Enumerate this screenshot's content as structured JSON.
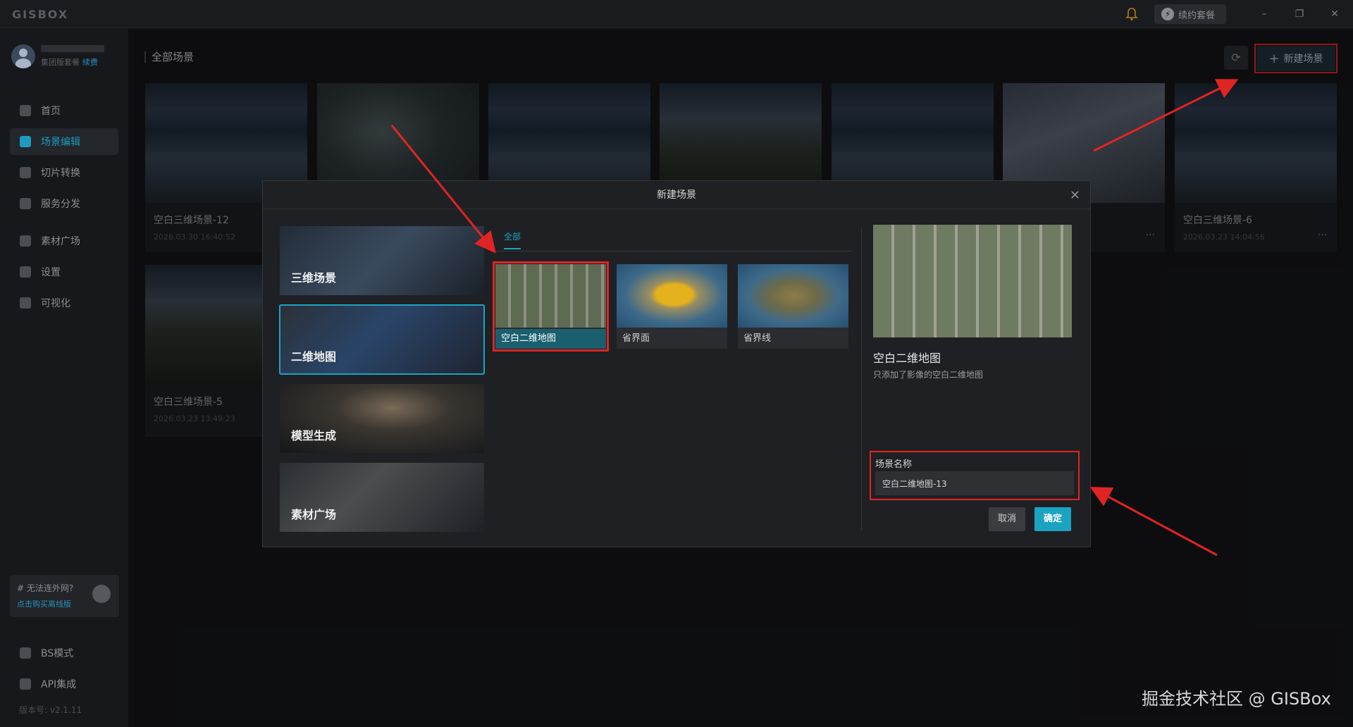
{
  "app": {
    "logo": "GISBOX"
  },
  "titlebar": {
    "renew_label": "续约套餐",
    "minimize": "–",
    "restore": "❐",
    "close": "✕"
  },
  "user": {
    "plan": "集团版套餐",
    "renew": "续费"
  },
  "nav": [
    {
      "label": "首页",
      "icon": "home-icon"
    },
    {
      "label": "场景编辑",
      "icon": "cube-icon",
      "active": true
    },
    {
      "label": "切片转换",
      "icon": "convert-icon"
    },
    {
      "label": "服务分发",
      "icon": "upload-icon"
    },
    {
      "label": "素材广场",
      "icon": "image-icon"
    },
    {
      "label": "设置",
      "icon": "gear-icon"
    },
    {
      "label": "可视化",
      "icon": "chart-icon"
    }
  ],
  "offline": {
    "title": "# 无法连外网?",
    "link": "点击购买离线版"
  },
  "bottom_nav": [
    {
      "label": "BS模式",
      "icon": "code-icon"
    },
    {
      "label": "API集成",
      "icon": "link-icon"
    }
  ],
  "version": "版本号: v2.1.11",
  "main": {
    "breadcrumb": "全部场景",
    "new_button": "新建场景",
    "cards": [
      {
        "title": "空白三维场景-12",
        "date": "2026.03.30 16:40:52"
      },
      {
        "title": "空白三维场景-6",
        "date": "2026.03.23 14:04:56"
      },
      {
        "title": "空白三维场景-5",
        "date": "2026.03.23 13:49:23"
      }
    ],
    "more": "···"
  },
  "modal": {
    "title": "新建场景",
    "close": "✕",
    "categories": [
      "三维场景",
      "二维地图",
      "模型生成",
      "素材广场"
    ],
    "selected_category": "二维地图",
    "tabs": [
      "全部"
    ],
    "templates": [
      "空白二维地图",
      "省界面",
      "省界线"
    ],
    "selected_template": "空白二维地图",
    "preview_title": "空白二维地图",
    "preview_desc": "只添加了影像的空白二维地图",
    "name_label": "场景名称",
    "name_value": "空白二维地图-13",
    "cancel": "取消",
    "ok": "确定"
  },
  "watermark": "掘金技术社区 @ GISBox",
  "colors": {
    "accent": "#1ba3c2",
    "annotation": "#e02424",
    "background": "#141517"
  }
}
